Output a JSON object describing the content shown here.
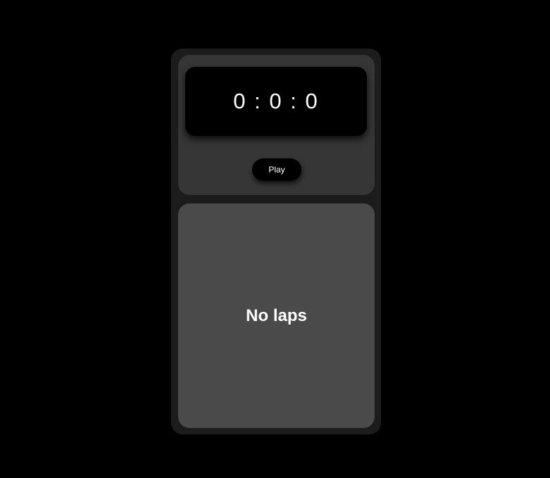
{
  "stopwatch": {
    "time_display": "0 : 0 : 0",
    "play_label": "Play"
  },
  "laps": {
    "empty_message": "No laps"
  },
  "colors": {
    "page_background": "#000000",
    "frame_background": "#1c1c1c",
    "timer_panel_background": "#363636",
    "laps_panel_background": "#4a4a4a",
    "display_background": "#000000",
    "text": "#ffffff"
  }
}
